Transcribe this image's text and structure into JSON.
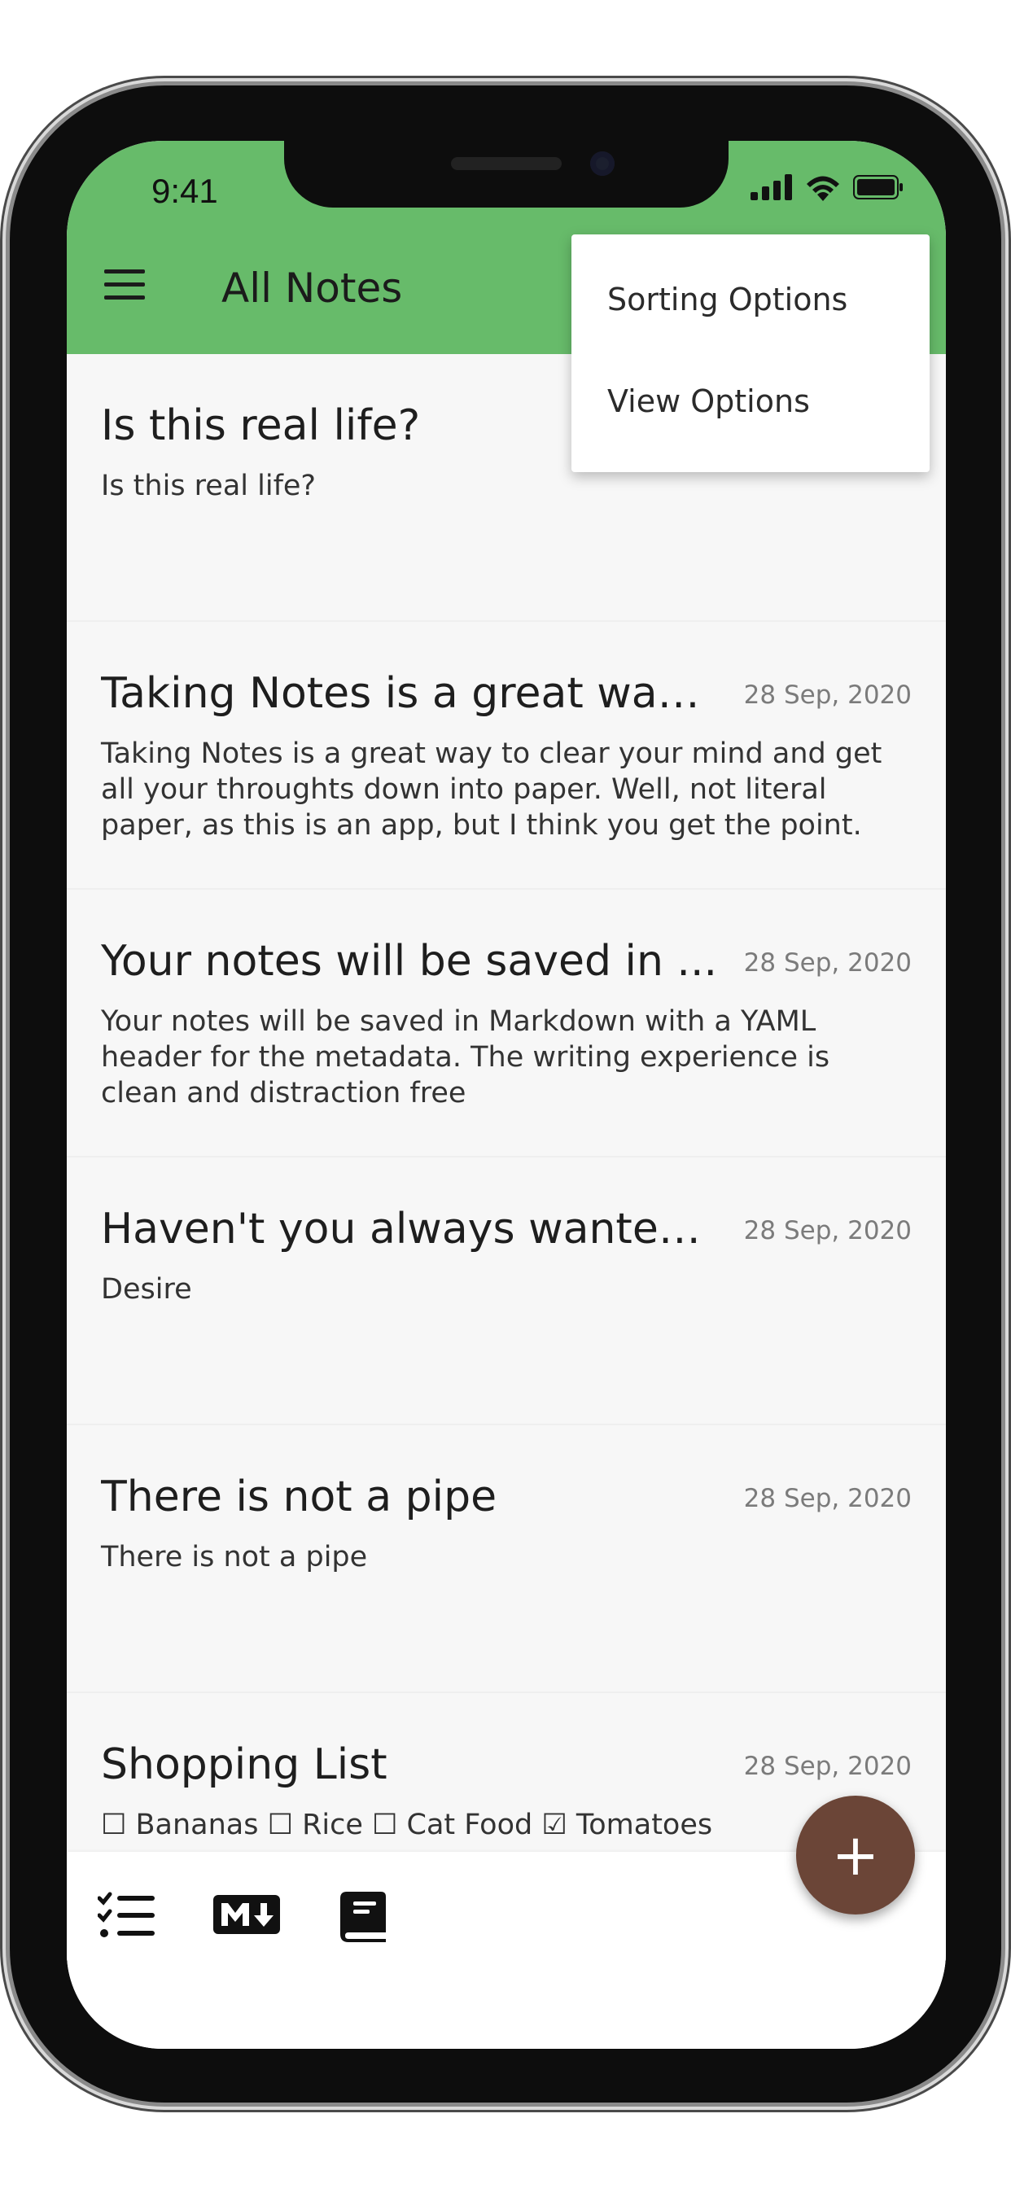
{
  "status_bar": {
    "time": "9:41"
  },
  "appbar": {
    "title": "All Notes"
  },
  "menu": {
    "items": [
      "Sorting Options",
      "View Options"
    ]
  },
  "notes": [
    {
      "title": "Is this real life?",
      "date": "",
      "body": "Is this real life?"
    },
    {
      "title": "Taking Notes is a great way to...",
      "date": "28 Sep, 2020",
      "body": "Taking Notes is a great way to clear your mind and get all your throughts down into paper. Well, not literal paper, as this is an app, but I think you get the point."
    },
    {
      "title": "Your notes will be saved in ...",
      "date": "28 Sep, 2020",
      "body": "Your notes will be saved in Markdown with a YAML header for the metadata. The writing experience is clean and distraction free"
    },
    {
      "title": "Haven't you always wanted ...",
      "date": "28 Sep, 2020",
      "body": "Desire"
    },
    {
      "title": "There is not a pipe",
      "date": "28 Sep, 2020",
      "body": "There is not a pipe"
    },
    {
      "title": "Shopping List",
      "date": "28 Sep, 2020",
      "body": "☐ Bananas ☐ Rice ☐ Cat Food ☑ Tomatoes"
    }
  ],
  "bottom_bar": {
    "icons": [
      "checklist-icon",
      "markdown-icon",
      "notebook-icon"
    ]
  },
  "fab": {
    "label": "+"
  },
  "colors": {
    "appbar": "#67bb6a",
    "fab": "#6b4537"
  }
}
